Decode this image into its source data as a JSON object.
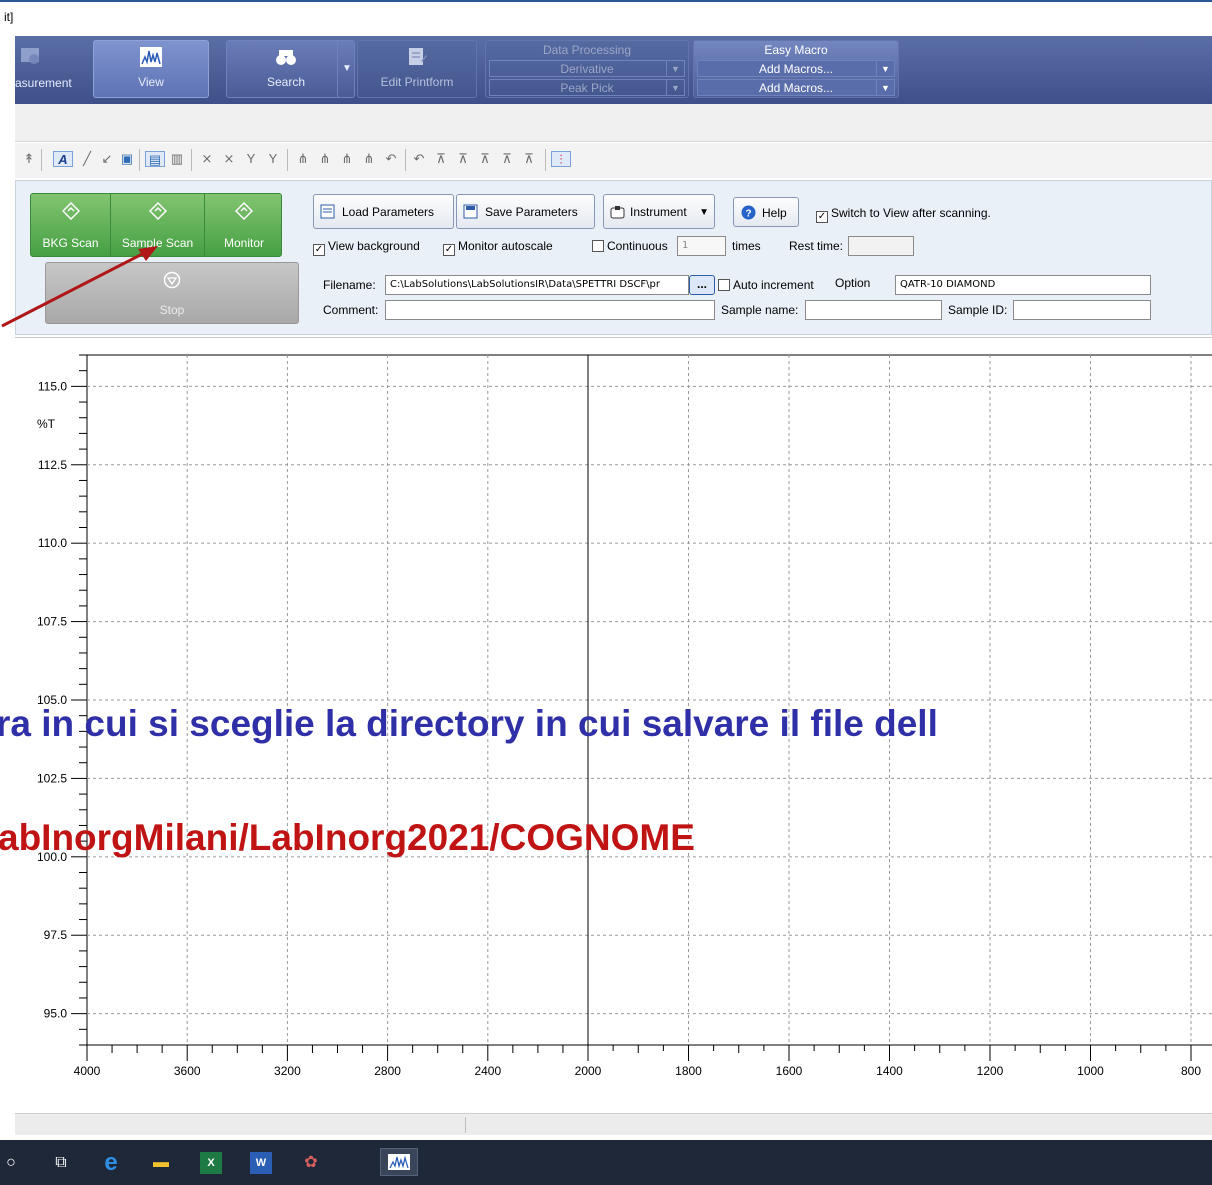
{
  "window": {
    "title_fragment": "it]"
  },
  "ribbon": {
    "measurement_label": "asurement",
    "view_label": "View",
    "search_label": "Search",
    "edit_printform_label": "Edit Printform",
    "data_processing": {
      "title": "Data Processing",
      "derivative": "Derivative",
      "peak_pick": "Peak Pick"
    },
    "easy_macro": {
      "title": "Easy Macro",
      "add_macros_1": "Add Macros...",
      "add_macros_2": "Add Macros..."
    }
  },
  "scan_panel": {
    "bkg_scan": "BKG Scan",
    "sample_scan": "Sample Scan",
    "monitor": "Monitor",
    "stop": "Stop",
    "load_parameters": "Load Parameters",
    "save_parameters": "Save Parameters",
    "instrument": "Instrument",
    "help": "Help",
    "switch_to_view": "Switch to View after scanning.",
    "view_background": "View background",
    "monitor_autoscale": "Monitor autoscale",
    "continuous": "Continuous",
    "continuous_value": "1",
    "times": "times",
    "rest_time": "Rest time:",
    "filename_label": "Filename:",
    "filename_value": "C:\\LabSolutions\\LabSolutionsIR\\Data\\SPETTRI DSCF\\pr",
    "browse": "...",
    "auto_increment": "Auto increment",
    "option_label": "Option",
    "option_value": "QATR-10 DIAMOND",
    "comment_label": "Comment:",
    "sample_name_label": "Sample name:",
    "sample_id_label": "Sample ID:"
  },
  "chart_data": {
    "type": "line",
    "series": [],
    "ylabel": "%T",
    "ylim": [
      94.0,
      116.0
    ],
    "yticks": [
      "115.0",
      "112.5",
      "110.0",
      "107.5",
      "105.0",
      "102.5",
      "100.0",
      "97.5",
      "95.0"
    ],
    "xlim": [
      4000,
      800
    ],
    "xticks": [
      "4000",
      "3600",
      "3200",
      "2800",
      "2400",
      "2000",
      "1800",
      "1600",
      "1400",
      "1200",
      "1000",
      "800"
    ],
    "grid": true
  },
  "overlay": {
    "line1": "ra in cui si sceglie la directory in cui salvare il file dell",
    "line2": "abInorgMilani/LabInorg2021/COGNOME"
  },
  "colors": {
    "overlay_line1": "#2f2fa8",
    "overlay_line2": "#c01414",
    "arrow": "#b01818",
    "scan_green": "#46a043"
  },
  "taskbar": {
    "icons": [
      "cortana-icon",
      "task-view-icon",
      "edge-icon",
      "file-explorer-icon",
      "excel-icon",
      "word-icon",
      "app-icon",
      "labsolutions-icon"
    ]
  }
}
